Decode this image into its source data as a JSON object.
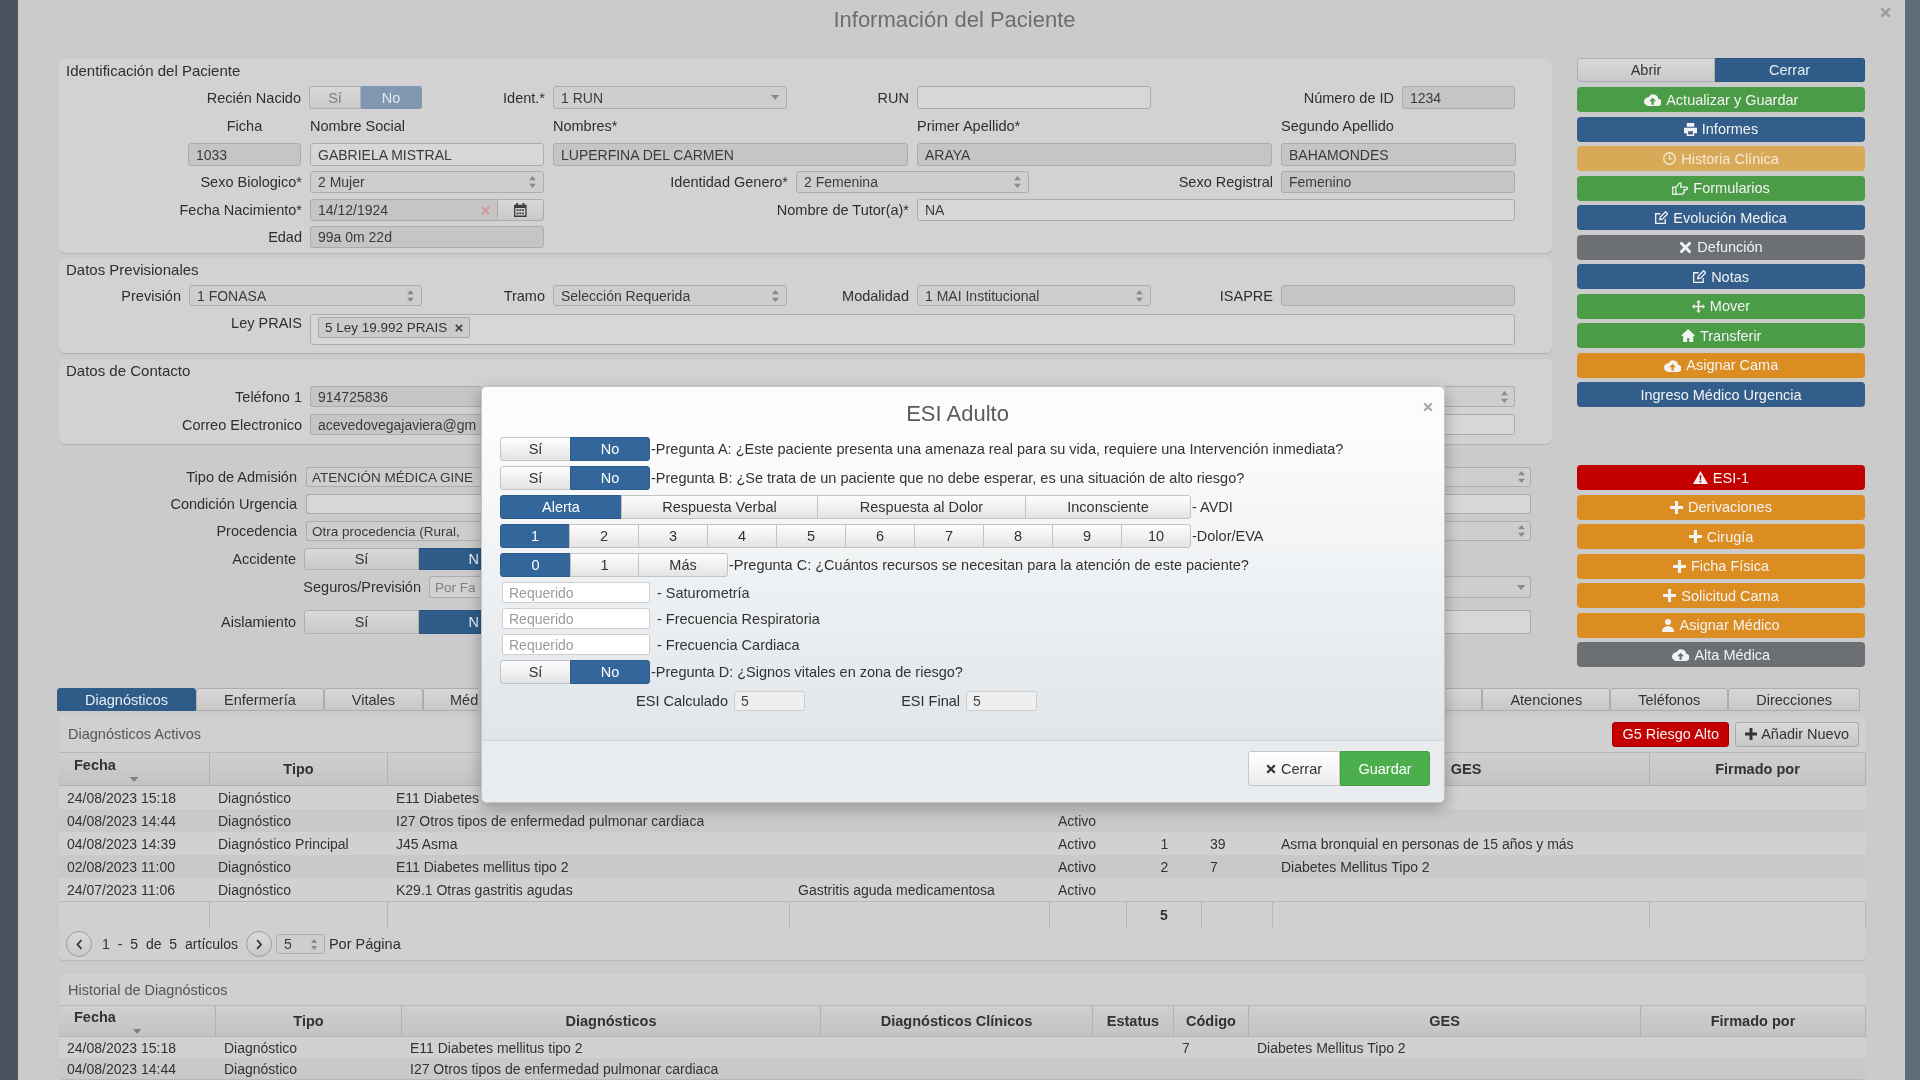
{
  "window": {
    "title": "Información del Paciente"
  },
  "identificacion": {
    "title": "Identificación del Paciente",
    "recien_nacido": {
      "label": "Recién Nacido",
      "disabled": true,
      "options": [
        {
          "label": "Sí",
          "selected": false
        },
        {
          "label": "No",
          "selected": true
        }
      ]
    },
    "ident": {
      "label": "Ident.*",
      "value": "1 RUN"
    },
    "run": {
      "label": "RUN",
      "readonly": false
    },
    "numero_id": {
      "label": "Número de ID",
      "value": "1234",
      "readonly": true
    },
    "ficha": {
      "label": "Ficha",
      "value": "1033",
      "readonly": true
    },
    "nombre_social": {
      "label": "Nombre Social",
      "value": "GABRIELA MISTRAL",
      "readonly": false
    },
    "nombres": {
      "label": "Nombres*",
      "value": "LUPERFINA DEL CARMEN",
      "readonly": true
    },
    "primer_apellido": {
      "label": "Primer Apellido*",
      "value": "ARAYA",
      "readonly": true
    },
    "segundo_apellido": {
      "label": "Segundo Apellido",
      "value": "BAHAMONDES",
      "readonly": true
    },
    "sexo_biologico": {
      "label": "Sexo Biologico*",
      "value": "2 Mujer"
    },
    "identidad_genero": {
      "label": "Identidad Genero*",
      "value": "2 Femenina"
    },
    "sexo_registral": {
      "label": "Sexo Registral",
      "value": "Femenino",
      "readonly": true
    },
    "fecha_nacimiento": {
      "label": "Fecha Nacimiento*",
      "value": "14/12/1924",
      "readonly": true
    },
    "nombre_tutor": {
      "label": "Nombre de Tutor(a)*",
      "value": "NA",
      "readonly": false
    },
    "edad": {
      "label": "Edad",
      "value": "99a 0m 22d",
      "readonly": true
    }
  },
  "previsionales": {
    "title": "Datos Previsionales",
    "prevision": {
      "label": "Previsión",
      "value": "1 FONASA"
    },
    "tramo": {
      "label": "Tramo",
      "value": "Selección Requerida"
    },
    "modalidad": {
      "label": "Modalidad",
      "value": "1 MAI Institucional"
    },
    "isapre": {
      "label": "ISAPRE",
      "readonly": true
    },
    "ley_prais": {
      "label": "Ley PRAIS",
      "tags": [
        "5 Ley 19.992 PRAIS"
      ]
    }
  },
  "contacto": {
    "title": "Datos de Contacto",
    "telefono": {
      "label": "Teléfono 1",
      "value": "914725836",
      "readonly": true
    },
    "correo": {
      "label": "Correo Electronico",
      "value": "acevedovegajaviera@gm",
      "readonly": true
    }
  },
  "admision": {
    "tipo_admision": {
      "label": "Tipo de Admisión",
      "value": "ATENCIÓN MÉDICA GINE"
    },
    "condicion_urgencia": {
      "label": "Condición Urgencia"
    },
    "procedencia": {
      "label": "Procedencia",
      "value": "Otra procedencia (Rural,"
    },
    "accidente": {
      "label": "Accidente",
      "options": [
        {
          "label": "Sí",
          "selected": false
        },
        {
          "label": "N",
          "selected": true
        }
      ]
    },
    "seguros_prevision": {
      "label": "Seguros/Previsión",
      "placeholder": "Por Fa"
    },
    "aislamiento": {
      "label": "Aislamiento",
      "options": [
        {
          "label": "Sí",
          "selected": false
        },
        {
          "label": "N",
          "selected": true
        }
      ]
    }
  },
  "panel_toggle": {
    "options": [
      {
        "label": "Abrir",
        "selected": false
      },
      {
        "label": "Cerrar",
        "selected": true
      }
    ]
  },
  "actions": [
    {
      "label": "Actualizar y Guardar",
      "color": "#4b9c47",
      "disabled": false
    },
    {
      "label": "Informes",
      "color": "#335e8b",
      "disabled": false
    },
    {
      "label": "Historia Clínica",
      "color": "#d8aa58",
      "disabled": true
    },
    {
      "label": "Formularios",
      "color": "#4b9c47",
      "disabled": false
    },
    {
      "label": "Evolución Medica",
      "color": "#335e8b",
      "disabled": false
    },
    {
      "label": "Defunción",
      "color": "#6c7075",
      "disabled": false
    },
    {
      "label": "Notas",
      "color": "#335e8b",
      "disabled": false
    },
    {
      "label": "Mover",
      "color": "#4b9c47",
      "disabled": false
    },
    {
      "label": "Transferir",
      "color": "#4b9c47",
      "disabled": false
    },
    {
      "label": "Asignar Cama",
      "color": "#dc8d22",
      "disabled": false
    },
    {
      "label": "Ingreso Médico Urgencia",
      "color": "#335e8b",
      "disabled": false
    }
  ],
  "clinical_actions": [
    {
      "label": "ESI-1",
      "color": "#c30000"
    },
    {
      "label": "Derivaciones",
      "color": "#dc8d22"
    },
    {
      "label": "Cirugía",
      "color": "#dc8d22"
    },
    {
      "label": "Ficha Física",
      "color": "#dc8d22"
    },
    {
      "label": "Solicitud Cama",
      "color": "#dc8d22"
    },
    {
      "label": "Asignar Médico",
      "color": "#dc8d22"
    },
    {
      "label": "Alta Médica",
      "color": "#6c7075"
    }
  ],
  "tabs": [
    {
      "label": "Diagnósticos",
      "selected": true
    },
    {
      "label": "Enfermería",
      "selected": false
    },
    {
      "label": "Vitales",
      "selected": false
    },
    {
      "label": "Méd",
      "selected": false
    },
    {
      "label": "Atenciones",
      "selected": false
    },
    {
      "label": "Teléfonos",
      "selected": false
    },
    {
      "label": "Direcciones",
      "selected": false
    }
  ],
  "diagnosticos_activos": {
    "title": "Diagnósticos Activos",
    "buttons": [
      {
        "label": "G5 Riesgo Alto",
        "kind": "danger"
      },
      {
        "label": "Añadir Nuevo",
        "kind": "add"
      }
    ],
    "columns": [
      {
        "label": "Fecha",
        "sorted": true
      },
      {
        "label": "Tipo",
        "sorted": false
      },
      {
        "label": "GES",
        "sorted": false
      },
      {
        "label": "Firmado por",
        "sorted": false
      }
    ],
    "rows": [
      {
        "fecha": "24/08/2023 15:18",
        "tipo": "Diagnóstico",
        "column_3": "E11 Diabetes"
      },
      {
        "fecha": "04/08/2023 14:44",
        "tipo": "Diagnóstico",
        "column_3": "I27 Otros tipos de enfermedad pulmonar cardiaca",
        "column_5": "Activo"
      },
      {
        "fecha": "04/08/2023 14:39",
        "tipo": "Diagnóstico Principal",
        "column_3": "J45 Asma",
        "column_5": "Activo",
        "column_6": "1",
        "column_7": "39",
        "ges": "Asma bronquial en personas de 15 años y más"
      },
      {
        "fecha": "02/08/2023 11:00",
        "tipo": "Diagnóstico",
        "column_3": "E11 Diabetes mellitus tipo 2",
        "column_5": "Activo",
        "column_6": "2",
        "column_7": "7",
        "ges": "Diabetes Mellitus Tipo 2"
      },
      {
        "fecha": "24/07/2023 11:06",
        "tipo": "Diagnóstico",
        "column_3": "K29.1 Otras gastritis agudas",
        "column_4": "Gastritis aguda medicamentosa",
        "column_5": "Activo"
      }
    ],
    "footer": {
      "column_6": "5"
    },
    "pagination": {
      "range": "1 - 5 de 5 artículos",
      "page_size": "5",
      "per_page": "Por Página"
    }
  },
  "historial": {
    "title": "Historial de Diagnósticos",
    "columns": [
      {
        "label": "Fecha",
        "sorted": true
      },
      {
        "label": "Tipo",
        "sorted": false
      },
      {
        "label": "Diagnósticos",
        "sorted": false
      },
      {
        "label": "Diagnósticos Clínicos",
        "sorted": false
      },
      {
        "label": "Estatus",
        "sorted": false
      },
      {
        "label": "Código",
        "sorted": false
      },
      {
        "label": "GES",
        "sorted": false
      },
      {
        "label": "Firmado por",
        "sorted": false
      }
    ],
    "rows": [
      {
        "fecha": "24/08/2023 15:18",
        "tipo": "Diagnóstico",
        "diagnosticos": "E11 Diabetes mellitus tipo 2",
        "codigo": "7",
        "ges": "Diabetes Mellitus Tipo 2"
      },
      {
        "fecha": "04/08/2023 14:44",
        "tipo": "Diagnóstico",
        "diagnosticos": "I27 Otros tipos de enfermedad pulmonar cardiaca"
      }
    ]
  },
  "esi_modal": {
    "title": "ESI Adulto",
    "rows": [
      {
        "kind": "choice",
        "options": [
          {
            "label": "Sí",
            "selected": false
          },
          {
            "label": "No",
            "selected": true
          }
        ],
        "text": "-Pregunta A: ¿Este paciente presenta una amenaza real para su vida, requiere una Intervención inmediata?"
      },
      {
        "kind": "choice",
        "options": [
          {
            "label": "Sí",
            "selected": false
          },
          {
            "label": "No",
            "selected": true
          }
        ],
        "text": "-Pregunta B: ¿Se trata de un paciente que no debe esperar, es una situación de alto riesgo?"
      },
      {
        "kind": "choice",
        "options": [
          {
            "label": "Alerta",
            "selected": true
          },
          {
            "label": "Respuesta Verbal",
            "selected": false
          },
          {
            "label": "Respuesta al Dolor",
            "selected": false
          },
          {
            "label": "Inconsciente",
            "selected": false
          }
        ],
        "text": "- AVDI"
      },
      {
        "kind": "choice",
        "options": [
          {
            "label": "1",
            "selected": true
          },
          {
            "label": "2",
            "selected": false
          },
          {
            "label": "3",
            "selected": false
          },
          {
            "label": "4",
            "selected": false
          },
          {
            "label": "5",
            "selected": false
          },
          {
            "label": "6",
            "selected": false
          },
          {
            "label": "7",
            "selected": false
          },
          {
            "label": "8",
            "selected": false
          },
          {
            "label": "9",
            "selected": false
          },
          {
            "label": "10",
            "selected": false
          }
        ],
        "text": "-Dolor/EVA"
      },
      {
        "kind": "choice",
        "options": [
          {
            "label": "0",
            "selected": true
          },
          {
            "label": "1",
            "selected": false
          },
          {
            "label": "Más",
            "selected": false
          }
        ],
        "text": "-Pregunta C: ¿Cuántos recursos se necesitan para la atención de este paciente?"
      },
      {
        "kind": "input",
        "placeholder": "Requerido",
        "text": "- Saturometría"
      },
      {
        "kind": "input",
        "placeholder": "Requerido",
        "text": "- Frecuencia Respiratoria"
      },
      {
        "kind": "input",
        "placeholder": "Requerido",
        "text": "- Frecuencia Cardiaca"
      },
      {
        "kind": "choice",
        "options": [
          {
            "label": "Sí",
            "selected": false
          },
          {
            "label": "No",
            "selected": true
          }
        ],
        "text": "-Pregunta D: ¿Signos vitales en zona de riesgo?"
      }
    ],
    "esi_calculado": {
      "label": "ESI Calculado",
      "value": "5"
    },
    "esi_final": {
      "label": "ESI Final",
      "value": "5"
    },
    "buttons": [
      {
        "label": "Cerrar",
        "kind": "close"
      },
      {
        "label": "Guardar",
        "kind": "save"
      }
    ]
  }
}
